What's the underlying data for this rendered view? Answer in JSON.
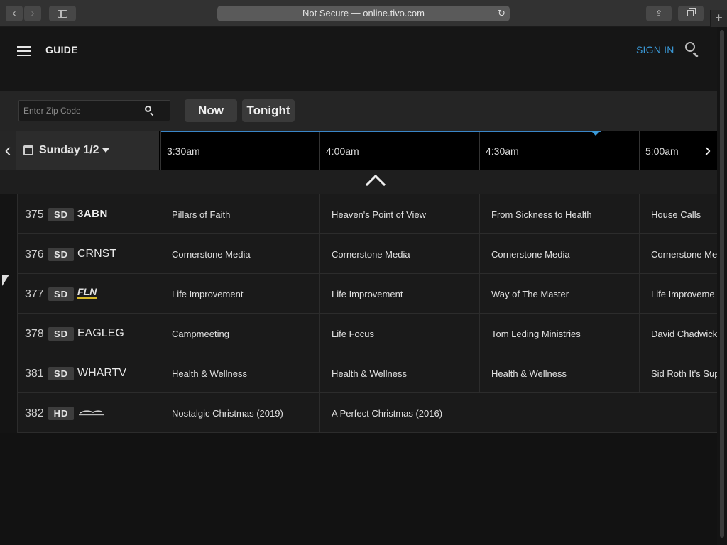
{
  "browser": {
    "url_text": "Not Secure — online.tivo.com",
    "back_glyph": "‹",
    "forward_glyph": "›",
    "reload_glyph": "↻",
    "share_glyph": "⇪",
    "new_tab_glyph": "+"
  },
  "header": {
    "title": "GUIDE",
    "sign_in": "SIGN IN",
    "accent_color": "#3a9ad9"
  },
  "filters": {
    "zip_placeholder": "Enter Zip Code",
    "now_label": "Now",
    "tonight_label": "Tonight"
  },
  "timeline": {
    "date_label": "Sunday 1/2",
    "slots": [
      "3:30am",
      "4:00am",
      "4:30am",
      "5:00am"
    ],
    "prev_glyph": "‹",
    "next_glyph": "›"
  },
  "channels": [
    {
      "number": "375",
      "quality": "SD",
      "name": "3ABN",
      "logo": "3abn-logo",
      "programs": [
        "Pillars of Faith",
        "Heaven's Point of View",
        "From Sickness to Health",
        "House Calls"
      ]
    },
    {
      "number": "376",
      "quality": "SD",
      "name": "CRNST",
      "logo": "",
      "programs": [
        "Cornerstone Media",
        "Cornerstone Media",
        "Cornerstone Media",
        "Cornerstone Me"
      ]
    },
    {
      "number": "377",
      "quality": "SD",
      "name": "FLN",
      "logo": "fln-logo",
      "programs": [
        "Life Improvement",
        "Life Improvement",
        "Way of The Master",
        "Life Improveme"
      ]
    },
    {
      "number": "378",
      "quality": "SD",
      "name": "EAGLEG",
      "logo": "",
      "programs": [
        "Campmeeting",
        "Life Focus",
        "Tom Leding Ministries",
        "David Chadwick"
      ]
    },
    {
      "number": "381",
      "quality": "SD",
      "name": "WHARTV",
      "logo": "",
      "programs": [
        "Health & Wellness",
        "Health & Wellness",
        "Health & Wellness",
        "Sid Roth It's Sup"
      ]
    },
    {
      "number": "382",
      "quality": "HD",
      "name": "",
      "logo": "hallmark-movies-logo",
      "programs": [
        "Nostalgic Christmas (2019)",
        "A Perfect Christmas (2016)"
      ]
    }
  ]
}
